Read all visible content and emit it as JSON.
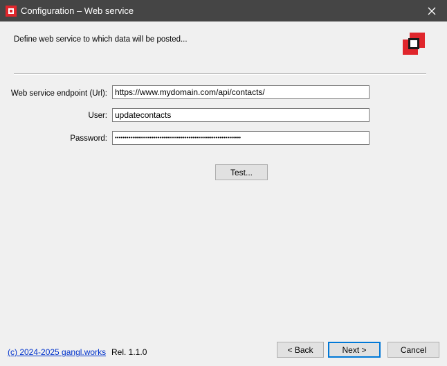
{
  "window": {
    "title": "Configuration – Web service"
  },
  "header": {
    "description": "Define web service to which data will be posted..."
  },
  "form": {
    "endpoint_label": "Web service endpoint (Url):",
    "endpoint_value": "https://www.mydomain.com/api/contacts/",
    "user_label": "User:",
    "user_value": "updatecontacts",
    "password_label": "Password:",
    "password_value": "•••••••••••••••••••••••••••••••••••••••••••••••••••••••••••••••••",
    "test_label": "Test..."
  },
  "footer": {
    "copyright": "(c) 2024-2025 gangl.works",
    "release": "Rel. 1.1.0",
    "back_label": "< Back",
    "next_label": "Next >",
    "cancel_label": "Cancel"
  },
  "colors": {
    "titlebar": "#454545",
    "brand_red": "#e0262c",
    "link": "#0033cc",
    "focus_blue": "#0078d7"
  },
  "icons": {
    "app": "app-logo-icon",
    "close": "close-icon",
    "header": "brand-logo-icon"
  }
}
